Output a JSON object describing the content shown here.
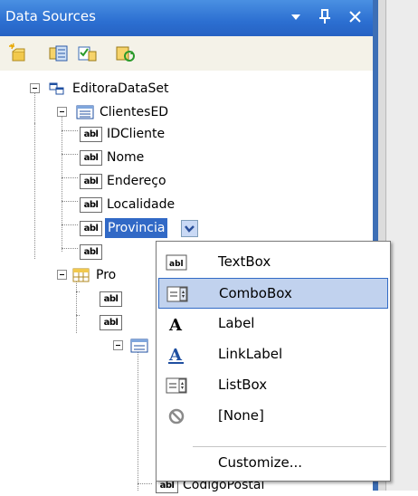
{
  "panel": {
    "title": "Data Sources",
    "dropdown_glyph": "▾",
    "pin_glyph": "ᛣ",
    "close_glyph": "✕"
  },
  "toolbar": {
    "tools": [
      "add-new-data-source-icon",
      "edit-dataset-icon",
      "configure-dataset-icon",
      "refresh-icon"
    ]
  },
  "tree": {
    "root": "EditoraDataSet",
    "table1": "ClientesED",
    "fields": [
      "IDCliente",
      "Nome",
      "Endereço",
      "Localidade",
      "Provincia"
    ],
    "table2_partial": "Pro",
    "last_field_partial": "CodigoPostal",
    "abl_tag": "abl"
  },
  "menu": {
    "items": [
      {
        "label": "TextBox",
        "icon": "textbox-icon"
      },
      {
        "label": "ComboBox",
        "icon": "combobox-icon"
      },
      {
        "label": "Label",
        "icon": "label-icon"
      },
      {
        "label": "LinkLabel",
        "icon": "linklabel-icon"
      },
      {
        "label": "ListBox",
        "icon": "listbox-icon"
      },
      {
        "label": "[None]",
        "icon": "none-icon"
      }
    ],
    "customize": "Customize...",
    "highlighted": "ComboBox"
  },
  "colors": {
    "titlebar": "#2c6fd1",
    "selection": "#3169c6",
    "menu_hover": "#c1d2ee",
    "menu_hover_border": "#316ac5"
  }
}
